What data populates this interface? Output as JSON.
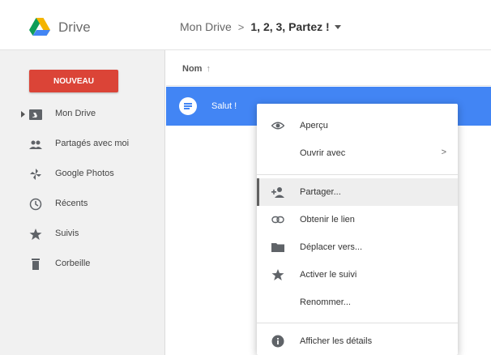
{
  "header": {
    "app_name": "Drive",
    "breadcrumb": {
      "root": "Mon Drive",
      "separator": ">",
      "current": "1, 2, 3, Partez !"
    }
  },
  "sidebar": {
    "new_button": "NOUVEAU",
    "items": [
      {
        "label": "Mon Drive",
        "icon": "drive-folder-icon"
      },
      {
        "label": "Partagés avec moi",
        "icon": "people-icon"
      },
      {
        "label": "Google Photos",
        "icon": "pinwheel-icon"
      },
      {
        "label": "Récents",
        "icon": "clock-icon"
      },
      {
        "label": "Suivis",
        "icon": "star-icon"
      },
      {
        "label": "Corbeille",
        "icon": "trash-icon"
      }
    ]
  },
  "list": {
    "column_name": "Nom",
    "sort_indicator": "↑",
    "files": [
      {
        "name": "Salut !",
        "icon": "doc-icon",
        "selected": true
      }
    ]
  },
  "context_menu": {
    "items": [
      {
        "label": "Aperçu",
        "icon": "eye-icon"
      },
      {
        "label": "Ouvrir avec",
        "submenu_indicator": ">"
      },
      {
        "label": "Partager...",
        "icon": "add-person-icon",
        "active": true
      },
      {
        "label": "Obtenir le lien",
        "icon": "link-icon"
      },
      {
        "label": "Déplacer vers...",
        "icon": "folder-icon"
      },
      {
        "label": "Activer le suivi",
        "icon": "star-icon"
      },
      {
        "label": "Renommer..."
      },
      {
        "label": "Afficher les détails",
        "icon": "info-icon"
      }
    ]
  },
  "colors": {
    "accent_red": "#db4437",
    "selection_blue": "#4285f4",
    "drive_green": "#0f9d58",
    "drive_yellow": "#f4b400",
    "drive_blue": "#4285f4"
  }
}
